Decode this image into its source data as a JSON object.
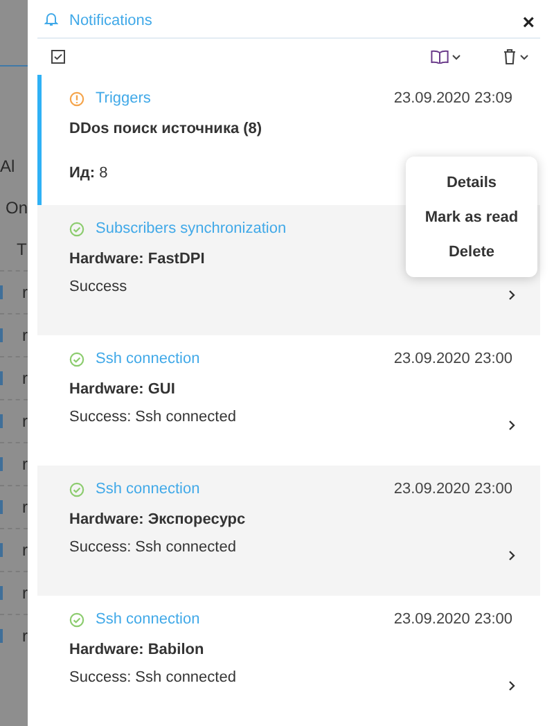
{
  "background": {
    "texts": [
      {
        "kind": "link",
        "text": "Al"
      },
      {
        "kind": "check",
        "text": "On"
      },
      {
        "kind": "head",
        "text": "T"
      },
      {
        "kind": "row",
        "text": "r"
      },
      {
        "kind": "row",
        "text": "r"
      },
      {
        "kind": "row",
        "text": "r"
      },
      {
        "kind": "row",
        "text": "r"
      },
      {
        "kind": "row",
        "text": "r"
      },
      {
        "kind": "row",
        "text": "r"
      },
      {
        "kind": "row",
        "text": "r"
      },
      {
        "kind": "row",
        "text": "r"
      },
      {
        "kind": "row",
        "text": "r"
      }
    ]
  },
  "panel": {
    "title": "Notifications",
    "close": "×"
  },
  "notifications": [
    {
      "kind": "warning",
      "category": "Triggers",
      "date": "23.09.2020 23:09",
      "title": "DDos поиск источника (8)",
      "detail": "**Ид:** 8",
      "selected": true
    },
    {
      "kind": "success",
      "category": "Subscribers synchronization",
      "title": "Hardware: FastDPI",
      "detail": "Success",
      "selected": false
    },
    {
      "kind": "success",
      "category": "Ssh connection",
      "date": "23.09.2020 23:00",
      "title": "Hardware: GUI",
      "detail": "Success: Ssh connected",
      "selected": false
    },
    {
      "kind": "success",
      "category": "Ssh connection",
      "date": "23.09.2020 23:00",
      "title": "Hardware: Экспоресурс",
      "detail": "Success: Ssh connected",
      "selected": false
    },
    {
      "kind": "success",
      "category": "Ssh connection",
      "date": "23.09.2020 23:00",
      "title": "Hardware: Babilon",
      "detail": "Success: Ssh connected",
      "selected": false
    }
  ],
  "context_menu": {
    "items": [
      "Details",
      "Mark as read",
      "Delete"
    ]
  }
}
